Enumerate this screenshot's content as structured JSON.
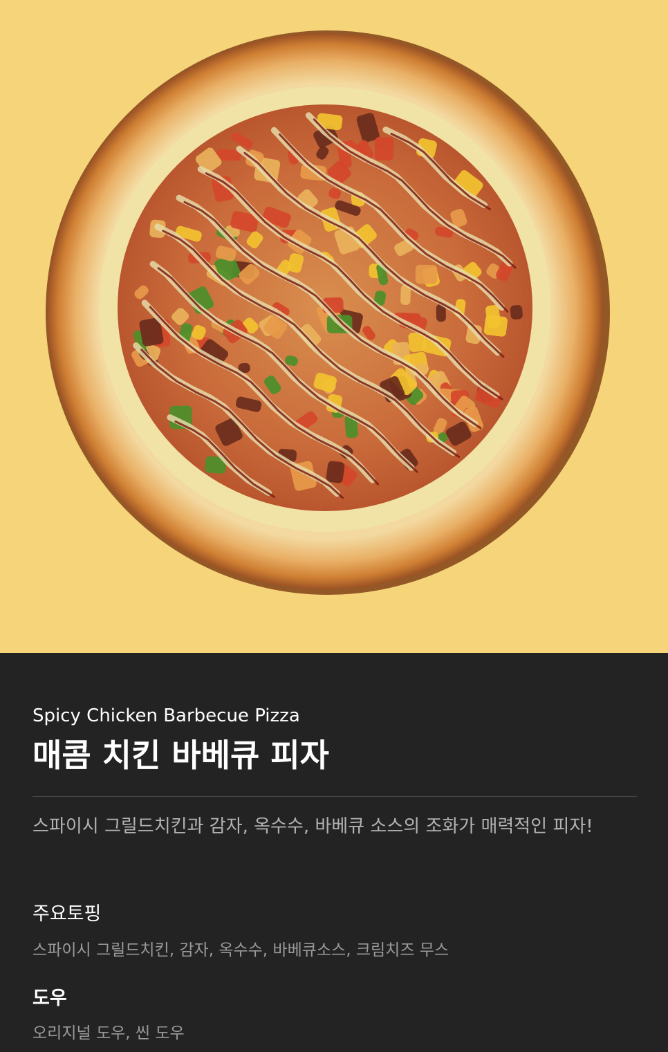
{
  "product": {
    "name_en": "Spicy Chicken Barbecue Pizza",
    "name_ko": "매콤 치킨 바베큐 피자",
    "description": "스파이시 그릴드치킨과 감자, 옥수수, 바베큐 소스의 조화가 매력적인 피자!"
  },
  "toppings": {
    "label": "주요토핑",
    "value": "스파이시 그릴드치킨, 감자, 옥수수, 바베큐소스, 크림치즈 무스"
  },
  "dough": {
    "label": "도우",
    "value": "오리지널 도우, 씬 도우"
  },
  "colors": {
    "hero_background": "#f6d57a",
    "panel_background": "#232323",
    "text_primary": "#ffffff",
    "text_secondary": "#b3b3b3"
  }
}
